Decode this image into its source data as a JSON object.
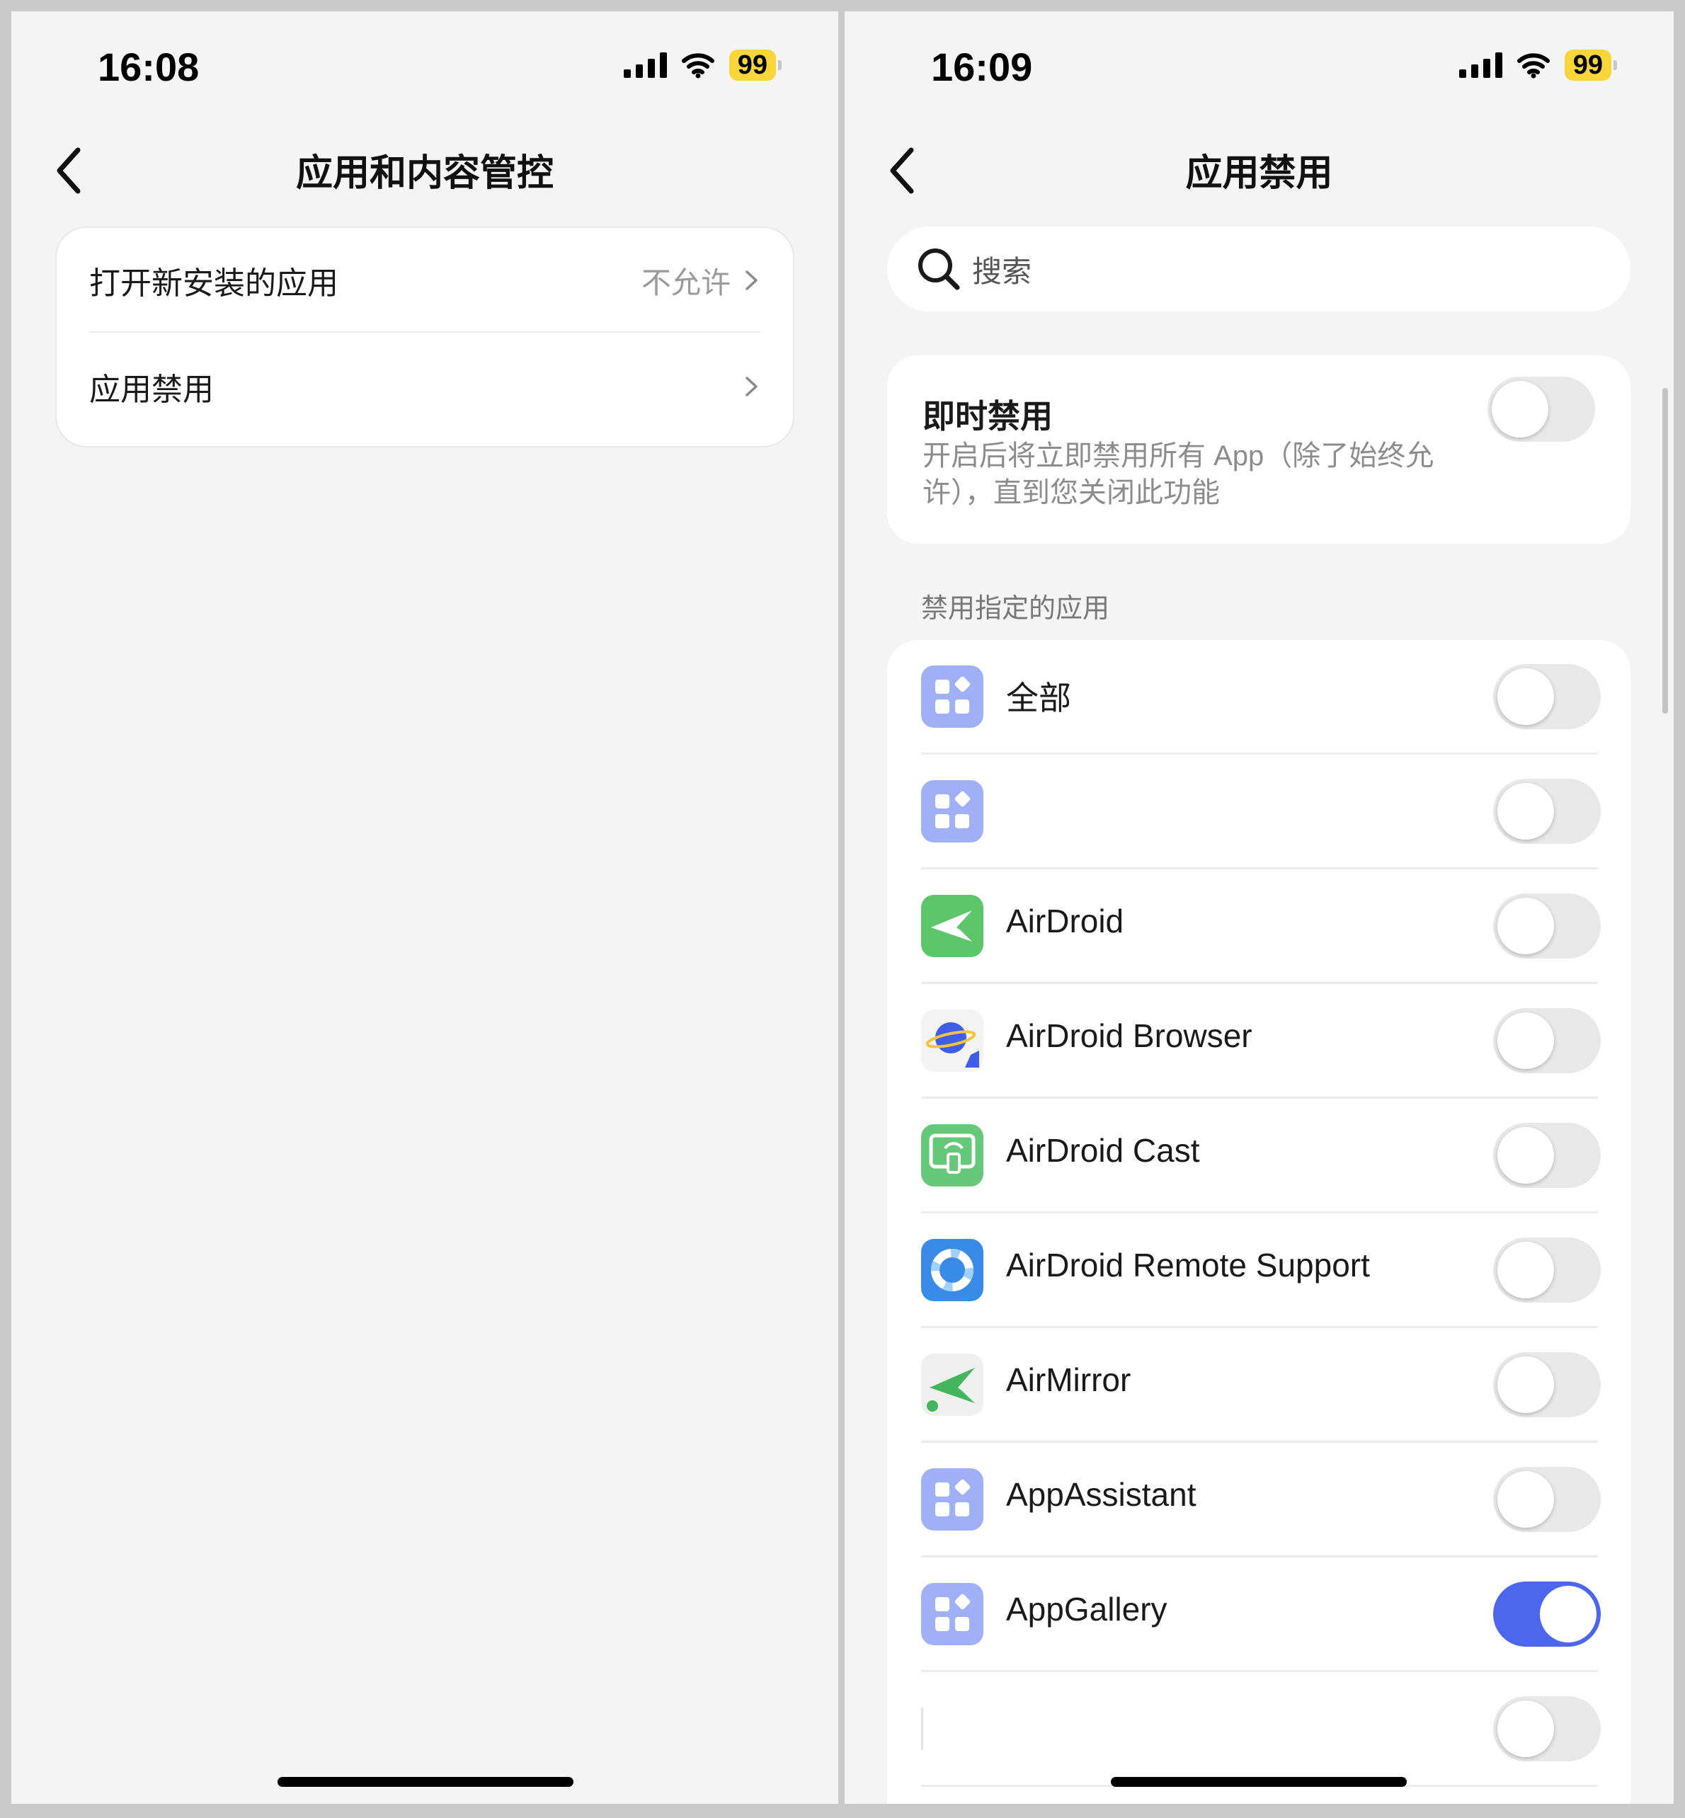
{
  "left": {
    "status": {
      "time": "16:08",
      "battery": "99"
    },
    "nav": {
      "title": "应用和内容管控"
    },
    "menu": [
      {
        "label": "打开新安装的应用",
        "value": "不允许"
      },
      {
        "label": "应用禁用",
        "value": ""
      }
    ]
  },
  "right": {
    "status": {
      "time": "16:09",
      "battery": "99"
    },
    "nav": {
      "title": "应用禁用"
    },
    "search": {
      "placeholder": "搜索"
    },
    "instant": {
      "title": "即时禁用",
      "description": "开启后将立即禁用所有 App（除了始终允许），直到您关闭此功能",
      "enabled": false
    },
    "section_label": "禁用指定的应用",
    "apps": [
      {
        "name": "全部",
        "icon": "generic-app-icon",
        "enabled": false
      },
      {
        "name": "",
        "icon": "generic-app-icon",
        "enabled": false
      },
      {
        "name": "AirDroid",
        "icon": "airdroid-icon",
        "enabled": false
      },
      {
        "name": "AirDroid Browser",
        "icon": "airdroid-browser-icon",
        "enabled": false
      },
      {
        "name": "AirDroid Cast",
        "icon": "airdroid-cast-icon",
        "enabled": false
      },
      {
        "name": "AirDroid Remote Support",
        "icon": "airdroid-remote-support-icon",
        "enabled": false
      },
      {
        "name": "AirMirror",
        "icon": "airmirror-icon",
        "enabled": false
      },
      {
        "name": "AppAssistant",
        "icon": "generic-app-icon",
        "enabled": false
      },
      {
        "name": "AppGallery",
        "icon": "generic-app-icon",
        "enabled": true
      },
      {
        "name": "",
        "icon": "blank-icon",
        "enabled": false
      }
    ]
  },
  "colors": {
    "accent": "#4c66ec",
    "battery": "#f8d63a",
    "background": "#f4f4f4"
  }
}
